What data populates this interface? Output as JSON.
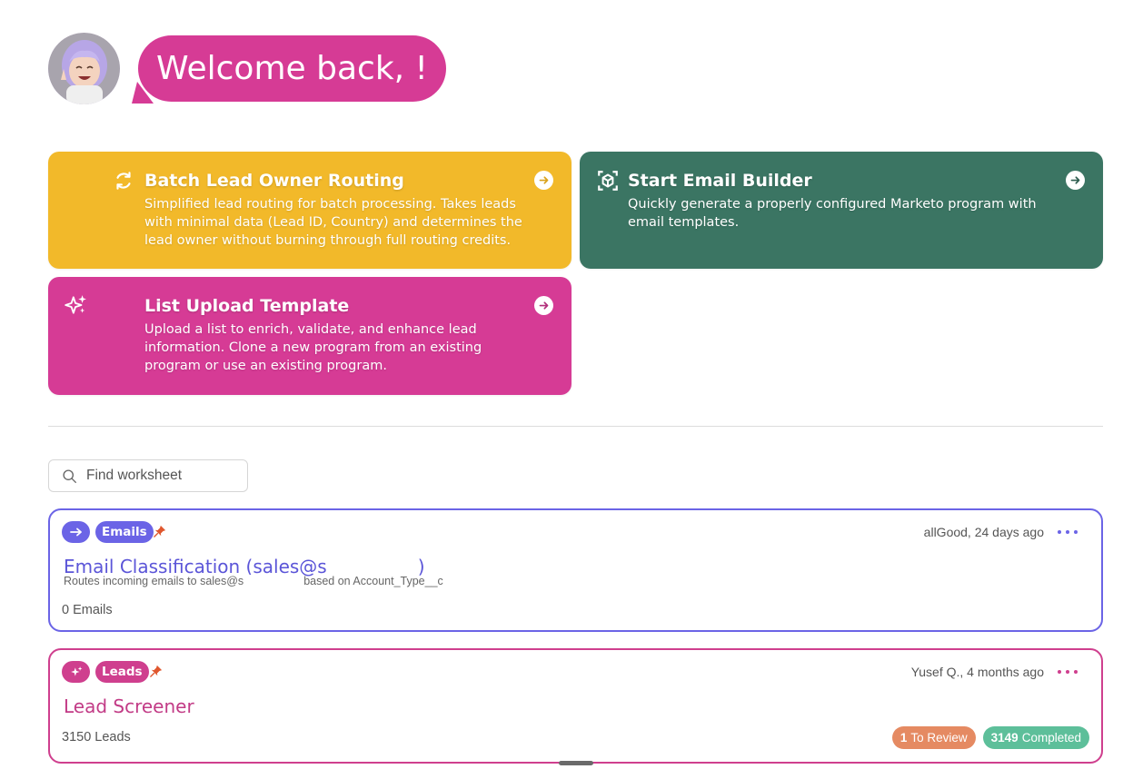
{
  "header": {
    "greeting": "Welcome back, !",
    "avatar_icon": "memoji-avatar"
  },
  "actions": [
    {
      "title": "Batch Lead Owner Routing",
      "description": "Simplified lead routing for batch processing. Takes leads with minimal data (Lead ID, Country) and determines the lead owner without burning through full routing credits.",
      "icon": "refresh-icon",
      "color": "#f2b92a"
    },
    {
      "title": "Start Email Builder",
      "description": "Quickly generate a properly configured Marketo program with email templates.",
      "icon": "cube-scan-icon",
      "color": "#3b7563"
    },
    {
      "title": "List Upload Template",
      "description": "Upload a list to enrich, validate, and enhance lead information. Clone a new program from an existing program or use an existing program.",
      "icon": "sparkles-icon",
      "color": "#d63b95"
    }
  ],
  "search": {
    "placeholder": "Find worksheet"
  },
  "worksheets": [
    {
      "type": "Emails",
      "type_icon": "arrow-right-icon",
      "pinned": true,
      "meta": "allGood, 24 days ago",
      "title_prefix": "Email Classification (sales@s",
      "title_suffix": ")",
      "subtitle_prefix": "Routes incoming emails to sales@s",
      "subtitle_suffix": "based on Account_Type__c",
      "count": "0 Emails",
      "color": "#6b64e6"
    },
    {
      "type": "Leads",
      "type_icon": "sparkles-icon",
      "pinned": true,
      "meta": "Yusef Q., 4 months ago",
      "title": "Lead Screener",
      "count": "3150 Leads",
      "review_count": "1",
      "review_label": "To Review",
      "completed_count": "3149",
      "completed_label": "Completed",
      "color": "#cf3f8e"
    }
  ]
}
